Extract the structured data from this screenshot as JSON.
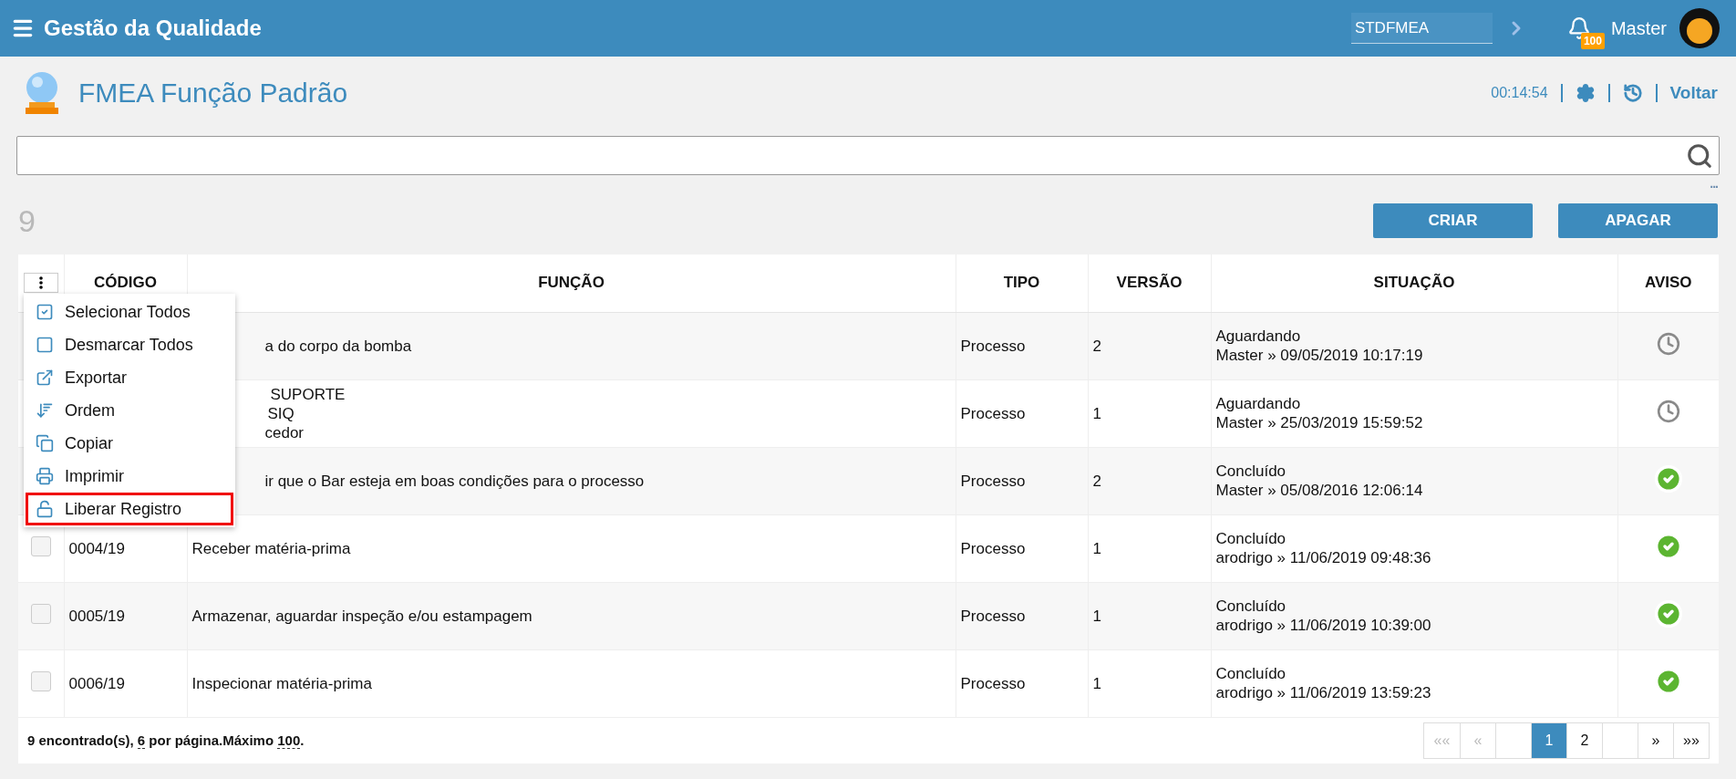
{
  "topbar": {
    "app_title": "Gestão da Qualidade",
    "context_field": {
      "value": "STDFMEA"
    },
    "notifications": {
      "badge": "100"
    },
    "user": {
      "name": "Master"
    }
  },
  "page": {
    "title": "FMEA Função Padrão",
    "timer": "00:14:54",
    "back_link": "Voltar"
  },
  "search": {
    "more": "..."
  },
  "record_count": "9",
  "actions": [
    "CRIAR",
    "APAGAR"
  ],
  "table": {
    "columns": [
      "CÓDIGO",
      "FUNÇÃO",
      "TIPO",
      "VERSÃO",
      "SITUAÇÃO",
      "AVISO"
    ],
    "rows": [
      {
        "function_lines": [
          "a do corpo da bomba"
        ],
        "type": "Processo",
        "version": "2",
        "status": "Aguardando",
        "stamp": "Master » 09/05/2019 10:17:19",
        "kind": "pending"
      },
      {
        "function_lines": [
          " SUPORTE",
          "SIQ",
          "cedor"
        ],
        "type": "Processo",
        "version": "1",
        "status": "Aguardando",
        "stamp": "Master » 25/03/2019 15:59:52",
        "kind": "pending"
      },
      {
        "function_lines": [
          "ir que o Bar esteja em boas condições para o processo"
        ],
        "type": "Processo",
        "version": "2",
        "status": "Concluído",
        "stamp": "Master » 05/08/2016 12:06:14",
        "kind": "done"
      },
      {
        "checked": false,
        "code": "0004/19",
        "function_lines": [
          "Receber matéria-prima"
        ],
        "type": "Processo",
        "version": "1",
        "status": "Concluído",
        "stamp": "arodrigo » 11/06/2019 09:48:36",
        "kind": "done"
      },
      {
        "checked": false,
        "code": "0005/19",
        "function_lines": [
          "Armazenar, aguardar inspeção e/ou estampagem"
        ],
        "type": "Processo",
        "version": "1",
        "status": "Concluído",
        "stamp": "arodrigo » 11/06/2019 10:39:00",
        "kind": "done"
      },
      {
        "checked": false,
        "code": "0006/19",
        "function_lines": [
          "Inspecionar matéria-prima"
        ],
        "type": "Processo",
        "version": "1",
        "status": "Concluído",
        "stamp": "arodrigo » 11/06/2019 13:59:23",
        "kind": "done"
      }
    ]
  },
  "row_menu": [
    {
      "kind": "select-all",
      "label": "Selecionar Todos",
      "selected": false
    },
    {
      "kind": "deselect",
      "label": "Desmarcar Todos",
      "selected": false
    },
    {
      "kind": "export",
      "label": "Exportar",
      "selected": false
    },
    {
      "kind": "order",
      "label": "Ordem",
      "selected": false
    },
    {
      "kind": "copy",
      "label": "Copiar",
      "selected": false
    },
    {
      "kind": "print",
      "label": "Imprimir",
      "selected": false
    },
    {
      "kind": "unlock",
      "label": "Liberar Registro",
      "selected": true
    }
  ],
  "footer": {
    "before": "9 encontrado(s), ",
    "per_page": "6",
    "middle": " por página.Máximo ",
    "max": "100",
    "after": "."
  },
  "pagination": [
    {
      "kind": "page",
      "label": "««",
      "selected": false,
      "disabled": true
    },
    {
      "kind": "page",
      "label": "«",
      "selected": false,
      "disabled": true
    },
    {
      "kind": "spacer"
    },
    {
      "kind": "page",
      "label": "1",
      "selected": true,
      "disabled": false
    },
    {
      "kind": "page",
      "label": "2",
      "selected": false,
      "disabled": false
    },
    {
      "kind": "spacer"
    },
    {
      "kind": "page",
      "label": "»",
      "selected": false,
      "disabled": false
    },
    {
      "kind": "page",
      "label": "»»",
      "selected": false,
      "disabled": false
    }
  ]
}
